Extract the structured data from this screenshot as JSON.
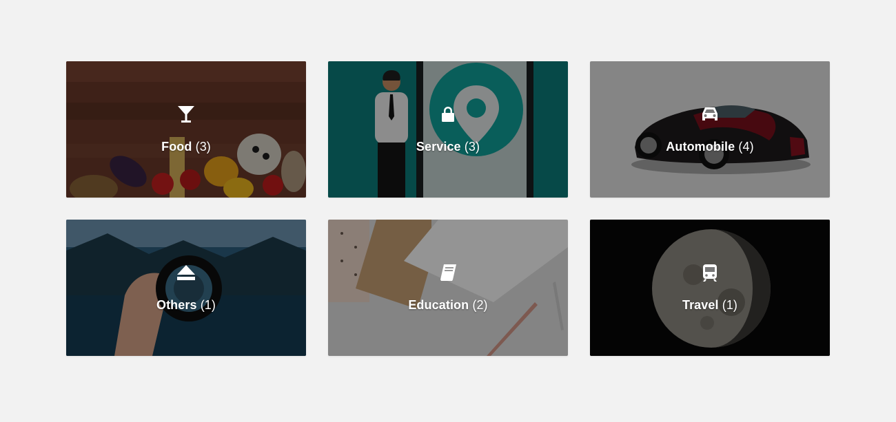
{
  "categories": [
    {
      "name": "Food",
      "count": "(3)",
      "icon": "cocktail-glass-icon"
    },
    {
      "name": "Service",
      "count": "(3)",
      "icon": "lock-icon"
    },
    {
      "name": "Automobile",
      "count": "(4)",
      "icon": "car-icon"
    },
    {
      "name": "Others",
      "count": "(1)",
      "icon": "eject-icon"
    },
    {
      "name": "Education",
      "count": "(2)",
      "icon": "book-icon"
    },
    {
      "name": "Travel",
      "count": "(1)",
      "icon": "train-icon"
    }
  ],
  "colors": {
    "page_background": "#f2f2f2",
    "overlay": "rgba(0,0,0,0.42)",
    "label": "#ffffff"
  }
}
